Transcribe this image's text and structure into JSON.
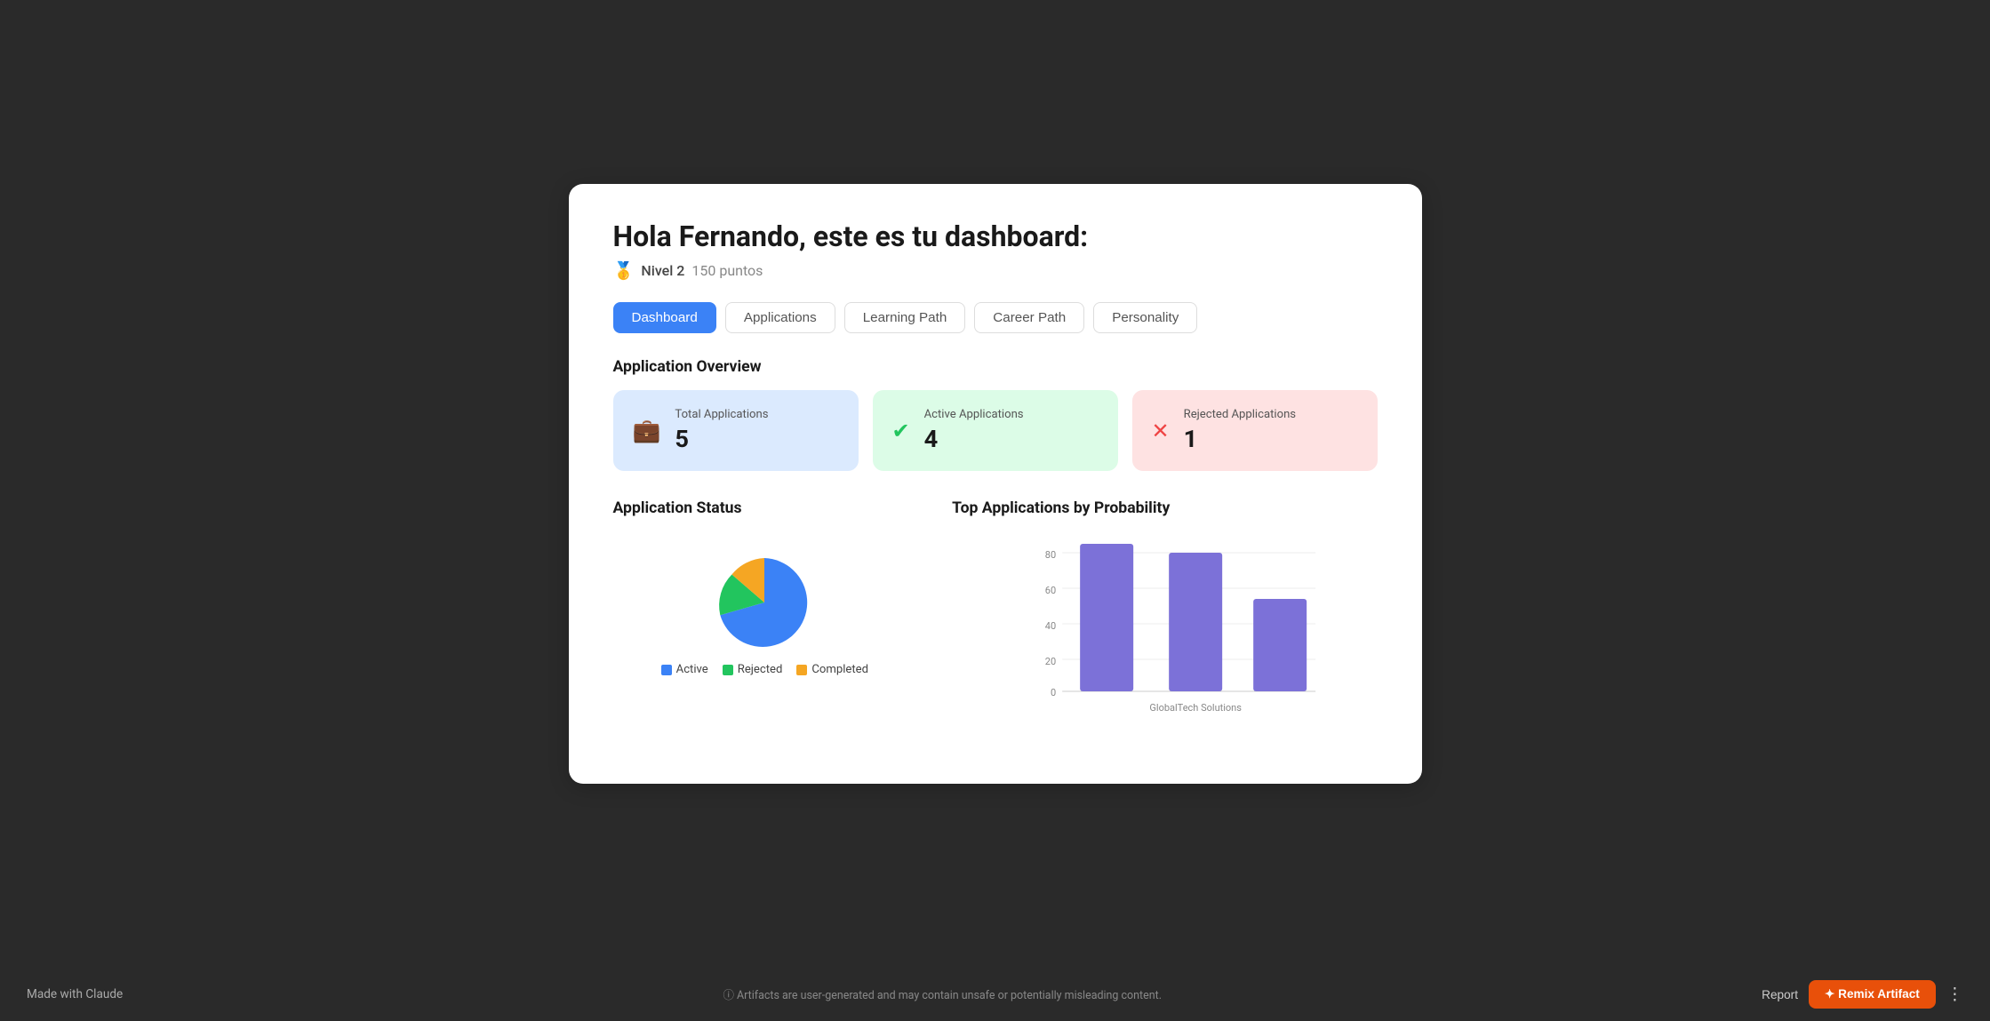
{
  "header": {
    "greeting": "Hola Fernando, este es tu dashboard:",
    "level_label": "Nivel 2",
    "points": "150 puntos",
    "level_icon": "🥇"
  },
  "tabs": [
    {
      "id": "dashboard",
      "label": "Dashboard",
      "active": true
    },
    {
      "id": "applications",
      "label": "Applications",
      "active": false
    },
    {
      "id": "learning_path",
      "label": "Learning Path",
      "active": false
    },
    {
      "id": "career_path",
      "label": "Career Path",
      "active": false
    },
    {
      "id": "personality",
      "label": "Personality",
      "active": false
    }
  ],
  "overview_title": "Application Overview",
  "stat_cards": [
    {
      "id": "total",
      "label": "Total Applications",
      "value": "5",
      "color": "blue",
      "icon": "💼"
    },
    {
      "id": "active",
      "label": "Active Applications",
      "value": "4",
      "color": "green",
      "icon": "✅"
    },
    {
      "id": "rejected",
      "label": "Rejected Applications",
      "value": "1",
      "color": "red",
      "icon": "❌"
    }
  ],
  "app_status_title": "Application Status",
  "legend": [
    {
      "id": "active",
      "label": "Active",
      "color": "#3b82f6"
    },
    {
      "id": "rejected",
      "label": "Rejected",
      "color": "#22c55e"
    },
    {
      "id": "completed",
      "label": "Completed",
      "color": "#f5a623"
    }
  ],
  "bar_chart_title": "Top Applications by Probability",
  "bar_chart": {
    "y_labels": [
      "0",
      "20",
      "40",
      "60",
      "80"
    ],
    "bars": [
      {
        "label": "GlobalTech",
        "value": 83,
        "color": "#7c71d8"
      },
      {
        "label": "Solutions",
        "value": 78,
        "color": "#7c71d8"
      },
      {
        "label": "",
        "value": 52,
        "color": "#7c71d8"
      }
    ],
    "x_label": "GlobalTech Solutions"
  },
  "footer": {
    "made_with": "Made with Claude",
    "disclaimer": "ⓘ Artifacts are user-generated and may contain unsafe or potentially misleading content.",
    "report_label": "Report",
    "remix_label": "✦ Remix Artifact",
    "more_icon": "⋮"
  }
}
